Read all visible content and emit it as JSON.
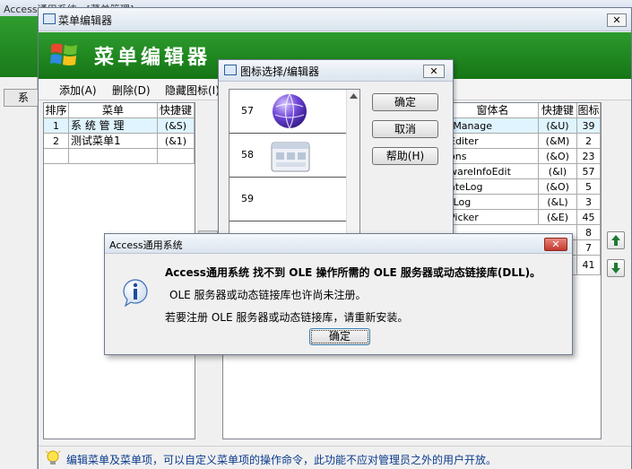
{
  "background_app": {
    "title": "Access通用系统 - [菜单管理]",
    "side_button": "系"
  },
  "menu_editor": {
    "title": "菜单编辑器",
    "banner_title": "菜单编辑器",
    "close_glyph": "✕",
    "toolbar": [
      {
        "label": "添加(A)"
      },
      {
        "label": "删除(D)"
      },
      {
        "label": "隐藏图标(I)"
      }
    ],
    "left_table": {
      "headers": [
        "排序",
        "菜单",
        "快捷键"
      ],
      "rows": [
        {
          "order": "1",
          "menu": "系 统 管 理",
          "shortcut": "(&S)"
        },
        {
          "order": "2",
          "menu": "测试菜单1",
          "shortcut": "(&1)"
        }
      ]
    },
    "right_table": {
      "headers": [
        "窗体名",
        "快捷键",
        "图标"
      ],
      "rows": [
        {
          "form": "tManage",
          "shortcut": "(&U)",
          "icon": "39"
        },
        {
          "form": "Editer",
          "shortcut": "(&M)",
          "icon": "2"
        },
        {
          "form": "ons",
          "shortcut": "(&O)",
          "icon": "23"
        },
        {
          "form": "wareInfoEdit",
          "shortcut": "(&I)",
          "icon": "57"
        },
        {
          "form": "ateLog",
          "shortcut": "(&O)",
          "icon": "5"
        },
        {
          "form": "rLog",
          "shortcut": "(&L)",
          "icon": "3"
        },
        {
          "form": "Picker",
          "shortcut": "(&E)",
          "icon": "45"
        },
        {
          "form": "",
          "shortcut": "",
          "icon": "8"
        },
        {
          "form": "",
          "shortcut": "",
          "icon": "7"
        },
        {
          "form": "",
          "shortcut": "",
          "icon": "41"
        }
      ]
    },
    "status_text": "编辑菜单及菜单项，可以自定义菜单项的操作命令，此功能不应对管理员之外的用户开放。"
  },
  "icon_picker": {
    "title": "图标选择/编辑器",
    "close_glyph": "✕",
    "items": [
      {
        "number": "57"
      },
      {
        "number": "58"
      },
      {
        "number": "59"
      }
    ],
    "buttons": {
      "ok": "确定",
      "cancel": "取消",
      "help": "帮助(H)"
    }
  },
  "error_dialog": {
    "title": "Access通用系统",
    "close_glyph": "✕",
    "icon": "info-icon",
    "line1": "Access通用系统 找不到 OLE 操作所需的 OLE 服务器或动态链接库(DLL)。",
    "line2": "OLE 服务器或动态链接库也许尚未注册。",
    "line3": "若要注册 OLE 服务器或动态链接库，请重新安装。",
    "ok_button": "确定"
  },
  "colors": {
    "banner_green": "#1f8a1f",
    "row_highlight": "#dff4ff",
    "close_red": "#c5392d"
  }
}
